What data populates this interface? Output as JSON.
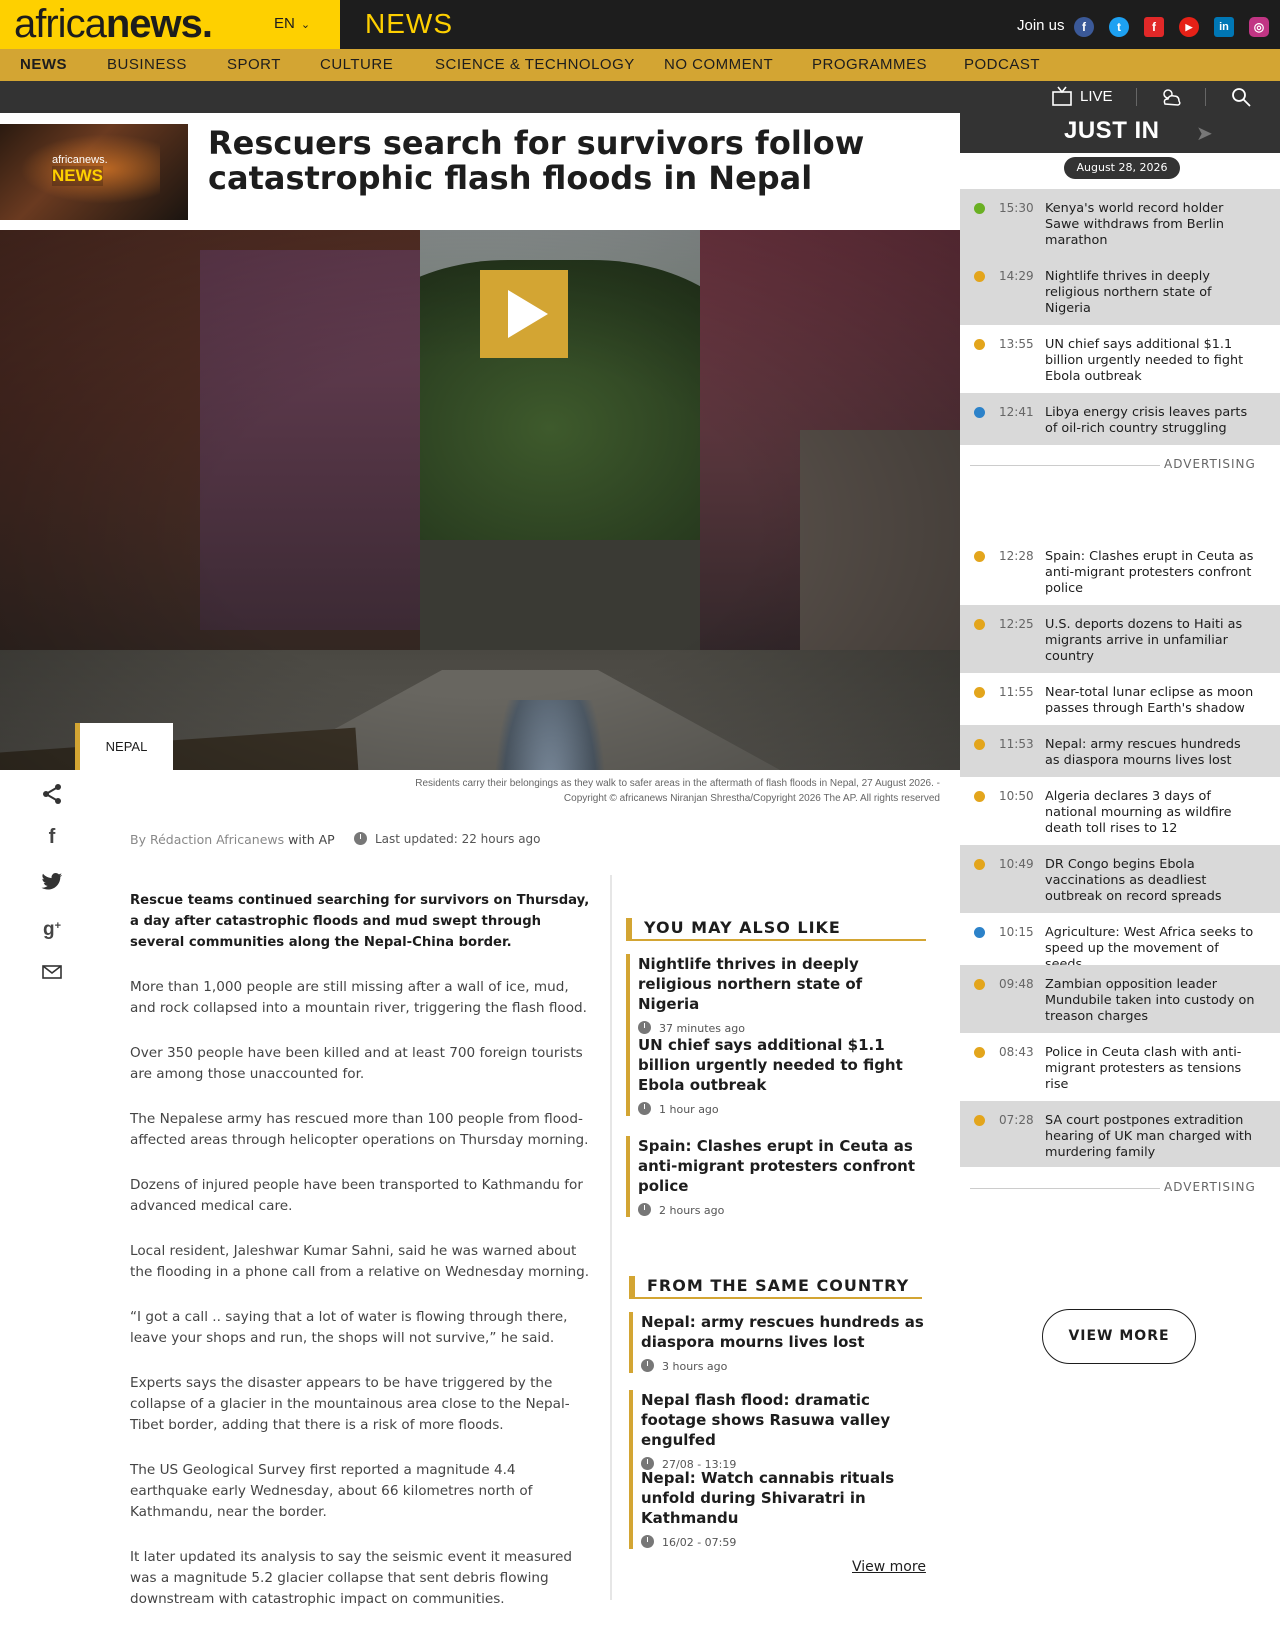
{
  "header": {
    "logo_prefix": "africa",
    "logo_bold": "news.",
    "language": "EN",
    "section": "NEWS",
    "join_label": "Join us",
    "social": [
      {
        "icon": "facebook-icon",
        "glyph": "f",
        "color": "#3b5998"
      },
      {
        "icon": "twitter-icon",
        "glyph": "t",
        "color": "#1da1f2"
      },
      {
        "icon": "flipboard-icon",
        "glyph": "f",
        "color": "#e12828"
      },
      {
        "icon": "youtube-icon",
        "glyph": "▶",
        "color": "#e62117"
      },
      {
        "icon": "linkedin-icon",
        "glyph": "in",
        "color": "#0077b5"
      },
      {
        "icon": "instagram-icon",
        "glyph": "◎",
        "color": "#c13584"
      }
    ]
  },
  "nav": {
    "items": [
      "NEWS",
      "BUSINESS",
      "SPORT",
      "CULTURE",
      "SCIENCE & TECHNOLOGY",
      "NO COMMENT",
      "PROGRAMMES",
      "PODCAST"
    ],
    "active": "NEWS"
  },
  "subbar": {
    "live_label": "LIVE",
    "icons": [
      "tv-icon",
      "weather-icon",
      "search-icon"
    ]
  },
  "article": {
    "thumb_logo": "africanews.",
    "thumb_section": "NEWS",
    "title": "Rescuers search for survivors follow catastrophic flash floods in Nepal",
    "country_tag": "NEPAL",
    "caption_line1": "Residents carry their belongings as they walk to safer areas in the aftermath of flash floods in Nepal, 27 August 2026.  -",
    "caption_line2": "Copyright © africanews  Niranjan Shrestha/Copyright 2026 The AP. All rights reserved",
    "author": "By Rédaction Africanews",
    "author_with": "with AP",
    "updated": "Last updated: 22 hours ago",
    "paragraphs": [
      "Rescue teams continued searching for survivors on Thursday, a day after catastrophic floods and mud swept through several communities along the Nepal-China border.",
      "More than 1,000 people are still missing after a wall of ice, mud, and rock collapsed into a mountain river, triggering the flash flood.",
      "Over 350 people have been killed and at least 700 foreign tourists are among those unaccounted for.",
      "The Nepalese army has rescued more than 100 people from flood-affected areas through helicopter operations on Thursday morning.",
      "Dozens of injured people have been transported to Kathmandu for advanced medical care.",
      "Local resident, Jaleshwar Kumar Sahni, said he was warned about the flooding in a phone call from a relative on Wednesday morning.",
      "“I got a call .. saying that a lot of water is flowing through there, leave your shops and run, the shops will not survive,” he said.",
      "Experts says the disaster appears to be have triggered by the collapse of a glacier in the mountainous area close to the Nepal-Tibet border, adding that there is a risk of more floods.",
      "The US Geological Survey first reported a magnitude 4.4 earthquake early Wednesday, about 66 kilometres north of Kathmandu, near the border.",
      "It later updated its analysis to say the seismic event it measured was a magnitude 5.2 glacier collapse that sent debris flowing downstream with catastrophic impact on communities."
    ]
  },
  "share_icons": [
    "share-icon",
    "facebook-share-icon",
    "twitter-share-icon",
    "googleplus-share-icon",
    "email-share-icon"
  ],
  "you_may_also_like": {
    "title": "YOU MAY ALSO LIKE",
    "items": [
      {
        "title": "Nightlife thrives in deeply religious northern state of Nigeria",
        "time": "37 minutes ago"
      },
      {
        "title": "UN chief says additional $1.1 billion urgently needed to fight Ebola outbreak",
        "time": "1 hour ago"
      },
      {
        "title": "Spain: Clashes erupt in Ceuta as anti-migrant protesters confront police",
        "time": "2 hours ago"
      }
    ]
  },
  "same_country": {
    "title": "FROM THE SAME COUNTRY",
    "items": [
      {
        "title": "Nepal: army rescues hundreds as diaspora mourns lives lost",
        "time": "3 hours ago"
      },
      {
        "title": "Nepal flash flood: dramatic footage shows Rasuwa valley engulfed",
        "time": "27/08 - 13:19"
      },
      {
        "title": "Nepal: Watch cannabis rituals unfold during Shivaratri in Kathmandu",
        "time": "16/02 - 07:59"
      }
    ],
    "view_more": "View more"
  },
  "just_in": {
    "title": "JUST IN",
    "date": "August 28, 2026",
    "advertising": "ADVERTISING",
    "view_more": "VIEW MORE",
    "items": [
      {
        "time": "15:30",
        "text": "Kenya's world record holder Sawe withdraws from Berlin marathon",
        "dot": "#6ab023"
      },
      {
        "time": "14:29",
        "text": "Nightlife thrives in deeply religious northern state of Nigeria",
        "dot": "#e3a51c"
      },
      {
        "time": "13:55",
        "text": "UN chief says additional $1.1 billion urgently needed to fight Ebola outbreak",
        "dot": "#e3a51c"
      },
      {
        "time": "12:41",
        "text": "Libya energy crisis leaves parts of oil-rich country struggling",
        "dot": "#2c82c9"
      },
      {
        "time": "12:28",
        "text": "Spain: Clashes erupt in Ceuta as anti-migrant protesters confront police",
        "dot": "#e3a51c"
      },
      {
        "time": "12:25",
        "text": "U.S. deports dozens to Haiti as migrants arrive in unfamiliar country",
        "dot": "#e3a51c"
      },
      {
        "time": "11:55",
        "text": "Near-total lunar eclipse as moon passes through Earth's shadow",
        "dot": "#e3a51c"
      },
      {
        "time": "11:53",
        "text": "Nepal: army rescues hundreds as diaspora mourns lives lost",
        "dot": "#e3a51c"
      },
      {
        "time": "10:50",
        "text": "Algeria declares 3 days of national mourning as wildfire death toll rises to 12",
        "dot": "#e3a51c"
      },
      {
        "time": "10:49",
        "text": "DR Congo begins Ebola vaccinations as deadliest outbreak on record spreads",
        "dot": "#e3a51c"
      },
      {
        "time": "10:15",
        "text": "Agriculture: West Africa seeks to speed up the movement of seeds",
        "dot": "#2c82c9"
      },
      {
        "time": "09:48",
        "text": "Zambian opposition leader Mundubile taken into custody on treason charges",
        "dot": "#e3a51c"
      },
      {
        "time": "08:43",
        "text": "Police in Ceuta clash with anti-migrant protesters as tensions rise",
        "dot": "#e3a51c"
      },
      {
        "time": "07:28",
        "text": "SA court postpones extradition hearing of UK man charged with murdering family",
        "dot": "#e3a51c"
      }
    ]
  }
}
